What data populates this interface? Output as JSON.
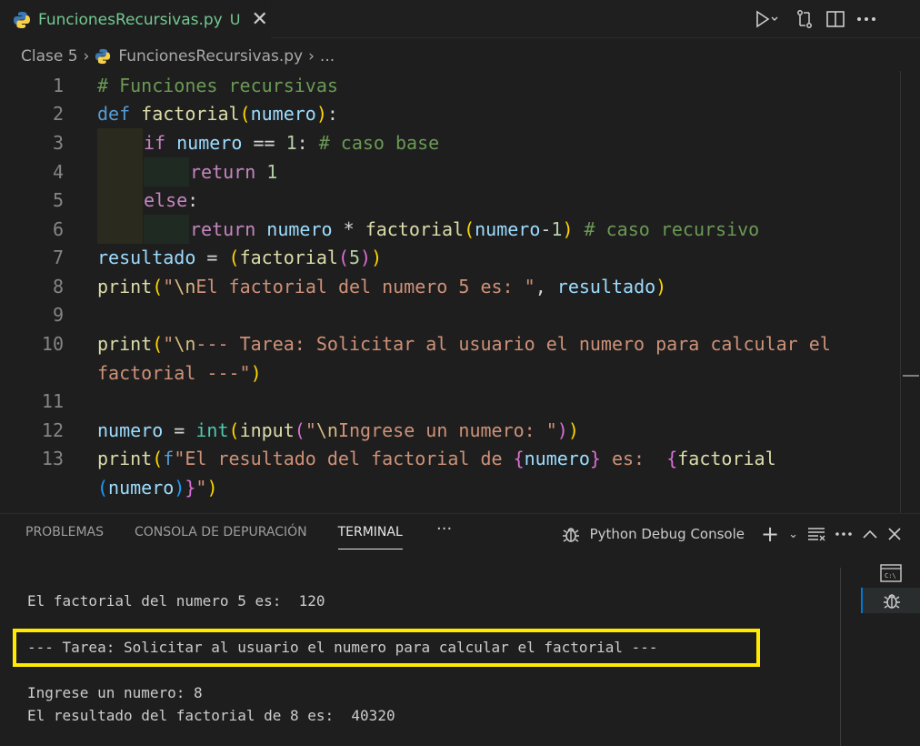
{
  "tab": {
    "filename": "FuncionesRecursivas.py",
    "state": "U",
    "close": "✕"
  },
  "breadcrumb": {
    "folder": "Clase 5",
    "file": "FuncionesRecursivas.py",
    "more": "..."
  },
  "editor": {
    "line_numbers": [
      "1",
      "2",
      "3",
      "4",
      "5",
      "6",
      "7",
      "8",
      "9",
      "10",
      "",
      "11",
      "12",
      "13",
      ""
    ]
  },
  "panel": {
    "tabs": [
      "PROBLEMAS",
      "CONSOLA DE DEPURACIÓN",
      "TERMINAL"
    ],
    "active_tab": "TERMINAL",
    "more": "···",
    "console_name": "Python Debug Console",
    "terminal_lines": [
      "El factorial del numero 5 es:  120",
      "--- Tarea: Solicitar al usuario el numero para calcular el factorial ---",
      "Ingrese un numero: 8",
      "El resultado del factorial de 8 es:  40320"
    ]
  },
  "colors": {
    "highlight_box": "#ffea00",
    "untracked_file": "#73c991",
    "accent": "#0078d4"
  }
}
